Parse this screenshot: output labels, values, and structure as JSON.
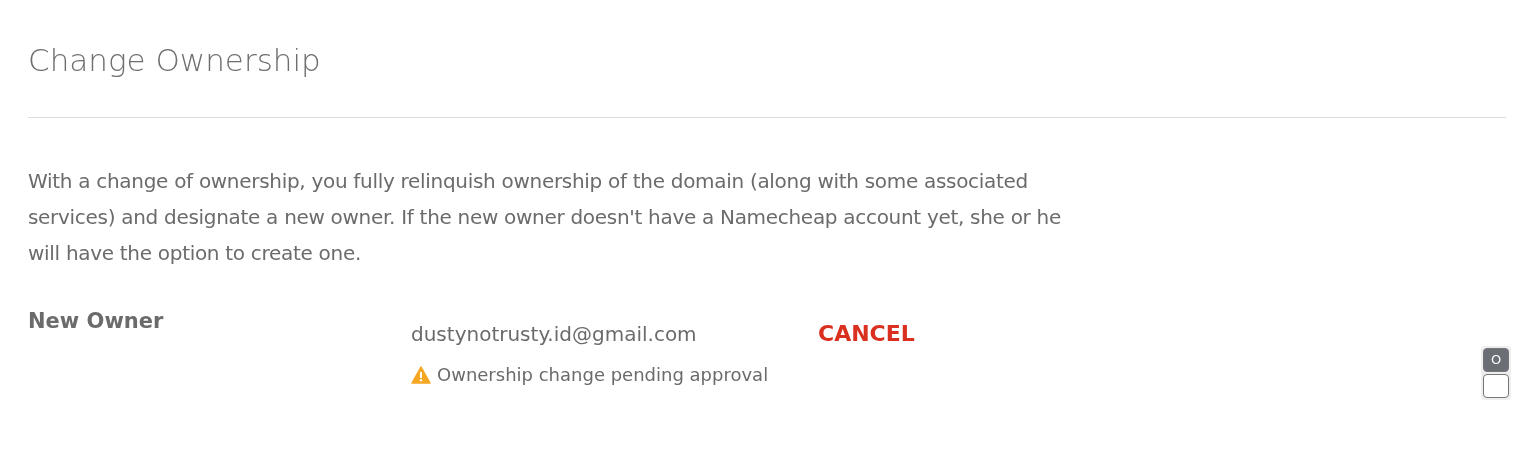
{
  "title": "Change Ownership",
  "description": "With a change of ownership, you fully relinquish ownership of the domain (along with some associated services) and designate a new owner. If the new owner doesn't have a Namecheap account yet, she or he will have the option to create one.",
  "new_owner": {
    "label": "New Owner",
    "email": "dustynotrusty.id@gmail.com",
    "action": "CANCEL",
    "status": {
      "kind": "warning",
      "text": "Ownership change pending approval"
    }
  },
  "side_widget": {
    "buttons": [
      {
        "label": "O",
        "selected": true
      },
      {
        "selected": false
      }
    ]
  }
}
